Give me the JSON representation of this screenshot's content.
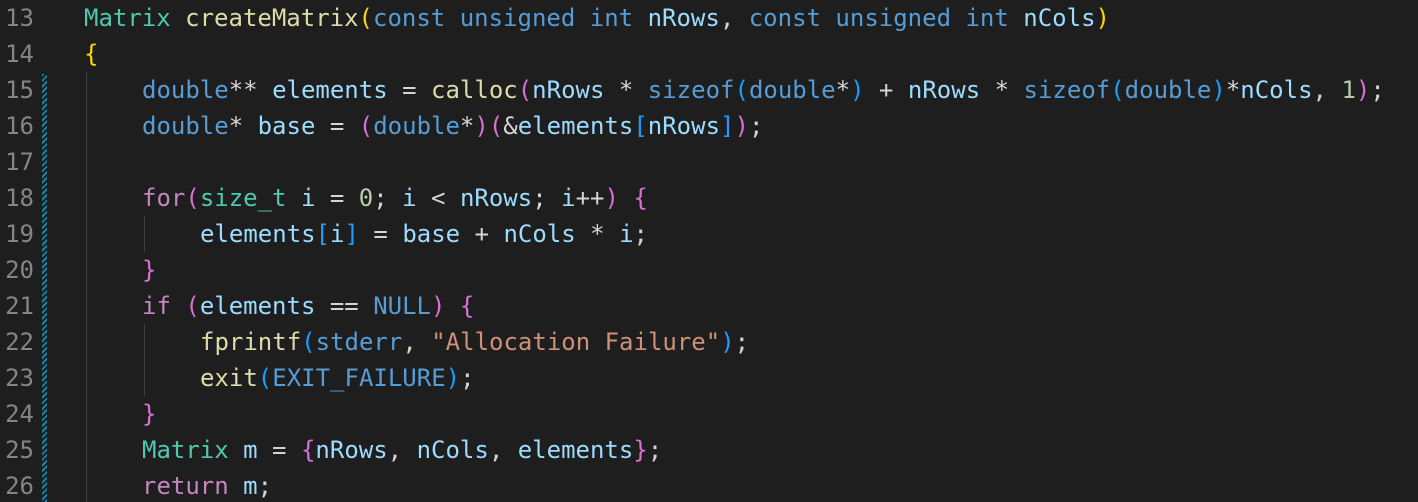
{
  "editor": {
    "line_numbers": [
      "13",
      "14",
      "15",
      "16",
      "17",
      "18",
      "19",
      "20",
      "21",
      "22",
      "23",
      "24",
      "25",
      "26"
    ],
    "lines": [
      {
        "indent": 0,
        "tokens": [
          {
            "t": "Matrix",
            "c": "type"
          },
          {
            "t": " ",
            "c": "op"
          },
          {
            "t": "createMatrix",
            "c": "fn"
          },
          {
            "t": "(",
            "c": "b1"
          },
          {
            "t": "const",
            "c": "kw"
          },
          {
            "t": " ",
            "c": "op"
          },
          {
            "t": "unsigned",
            "c": "kw"
          },
          {
            "t": " ",
            "c": "op"
          },
          {
            "t": "int",
            "c": "kw"
          },
          {
            "t": " ",
            "c": "op"
          },
          {
            "t": "nRows",
            "c": "var"
          },
          {
            "t": ", ",
            "c": "op"
          },
          {
            "t": "const",
            "c": "kw"
          },
          {
            "t": " ",
            "c": "op"
          },
          {
            "t": "unsigned",
            "c": "kw"
          },
          {
            "t": " ",
            "c": "op"
          },
          {
            "t": "int",
            "c": "kw"
          },
          {
            "t": " ",
            "c": "op"
          },
          {
            "t": "nCols",
            "c": "var"
          },
          {
            "t": ")",
            "c": "b1"
          }
        ]
      },
      {
        "indent": 0,
        "tokens": [
          {
            "t": "{",
            "c": "b1"
          }
        ]
      },
      {
        "indent": 1,
        "tokens": [
          {
            "t": "double",
            "c": "kw"
          },
          {
            "t": "** ",
            "c": "op"
          },
          {
            "t": "elements",
            "c": "var"
          },
          {
            "t": " = ",
            "c": "op"
          },
          {
            "t": "calloc",
            "c": "fn"
          },
          {
            "t": "(",
            "c": "b2"
          },
          {
            "t": "nRows",
            "c": "var"
          },
          {
            "t": " * ",
            "c": "op"
          },
          {
            "t": "sizeof",
            "c": "kw"
          },
          {
            "t": "(",
            "c": "b3"
          },
          {
            "t": "double",
            "c": "kw"
          },
          {
            "t": "*",
            "c": "op"
          },
          {
            "t": ")",
            "c": "b3"
          },
          {
            "t": " + ",
            "c": "op"
          },
          {
            "t": "nRows",
            "c": "var"
          },
          {
            "t": " * ",
            "c": "op"
          },
          {
            "t": "sizeof",
            "c": "kw"
          },
          {
            "t": "(",
            "c": "b3"
          },
          {
            "t": "double",
            "c": "kw"
          },
          {
            "t": ")",
            "c": "b3"
          },
          {
            "t": "*",
            "c": "op"
          },
          {
            "t": "nCols",
            "c": "var"
          },
          {
            "t": ", ",
            "c": "op"
          },
          {
            "t": "1",
            "c": "num"
          },
          {
            "t": ")",
            "c": "b2"
          },
          {
            "t": ";",
            "c": "op"
          }
        ]
      },
      {
        "indent": 1,
        "tokens": [
          {
            "t": "double",
            "c": "kw"
          },
          {
            "t": "* ",
            "c": "op"
          },
          {
            "t": "base",
            "c": "var"
          },
          {
            "t": " = ",
            "c": "op"
          },
          {
            "t": "(",
            "c": "b2"
          },
          {
            "t": "double",
            "c": "kw"
          },
          {
            "t": "*",
            "c": "op"
          },
          {
            "t": ")",
            "c": "b2"
          },
          {
            "t": "(",
            "c": "b2"
          },
          {
            "t": "&",
            "c": "op"
          },
          {
            "t": "elements",
            "c": "var"
          },
          {
            "t": "[",
            "c": "b3"
          },
          {
            "t": "nRows",
            "c": "var"
          },
          {
            "t": "]",
            "c": "b3"
          },
          {
            "t": ")",
            "c": "b2"
          },
          {
            "t": ";",
            "c": "op"
          }
        ]
      },
      {
        "indent": 1,
        "tokens": []
      },
      {
        "indent": 1,
        "tokens": [
          {
            "t": "for",
            "c": "ctrl"
          },
          {
            "t": "(",
            "c": "b2"
          },
          {
            "t": "size_t",
            "c": "type"
          },
          {
            "t": " ",
            "c": "op"
          },
          {
            "t": "i",
            "c": "var"
          },
          {
            "t": " = ",
            "c": "op"
          },
          {
            "t": "0",
            "c": "num"
          },
          {
            "t": "; ",
            "c": "op"
          },
          {
            "t": "i",
            "c": "var"
          },
          {
            "t": " < ",
            "c": "op"
          },
          {
            "t": "nRows",
            "c": "var"
          },
          {
            "t": "; ",
            "c": "op"
          },
          {
            "t": "i",
            "c": "var"
          },
          {
            "t": "++",
            "c": "op"
          },
          {
            "t": ")",
            "c": "b2"
          },
          {
            "t": " ",
            "c": "op"
          },
          {
            "t": "{",
            "c": "b2"
          }
        ]
      },
      {
        "indent": 2,
        "tokens": [
          {
            "t": "elements",
            "c": "var"
          },
          {
            "t": "[",
            "c": "b3"
          },
          {
            "t": "i",
            "c": "var"
          },
          {
            "t": "]",
            "c": "b3"
          },
          {
            "t": " = ",
            "c": "op"
          },
          {
            "t": "base",
            "c": "var"
          },
          {
            "t": " + ",
            "c": "op"
          },
          {
            "t": "nCols",
            "c": "var"
          },
          {
            "t": " * ",
            "c": "op"
          },
          {
            "t": "i",
            "c": "var"
          },
          {
            "t": ";",
            "c": "op"
          }
        ]
      },
      {
        "indent": 1,
        "tokens": [
          {
            "t": "}",
            "c": "b2"
          }
        ]
      },
      {
        "indent": 1,
        "tokens": [
          {
            "t": "if",
            "c": "ctrl"
          },
          {
            "t": " ",
            "c": "op"
          },
          {
            "t": "(",
            "c": "b2"
          },
          {
            "t": "elements",
            "c": "var"
          },
          {
            "t": " == ",
            "c": "op"
          },
          {
            "t": "NULL",
            "c": "kw"
          },
          {
            "t": ")",
            "c": "b2"
          },
          {
            "t": " ",
            "c": "op"
          },
          {
            "t": "{",
            "c": "b2"
          }
        ]
      },
      {
        "indent": 2,
        "tokens": [
          {
            "t": "fprintf",
            "c": "fn"
          },
          {
            "t": "(",
            "c": "b3"
          },
          {
            "t": "stderr",
            "c": "kw"
          },
          {
            "t": ", ",
            "c": "op"
          },
          {
            "t": "\"Allocation Failure\"",
            "c": "str"
          },
          {
            "t": ")",
            "c": "b3"
          },
          {
            "t": ";",
            "c": "op"
          }
        ]
      },
      {
        "indent": 2,
        "tokens": [
          {
            "t": "exit",
            "c": "fn"
          },
          {
            "t": "(",
            "c": "b3"
          },
          {
            "t": "EXIT_FAILURE",
            "c": "kw"
          },
          {
            "t": ")",
            "c": "b3"
          },
          {
            "t": ";",
            "c": "op"
          }
        ]
      },
      {
        "indent": 1,
        "tokens": [
          {
            "t": "}",
            "c": "b2"
          }
        ]
      },
      {
        "indent": 1,
        "tokens": [
          {
            "t": "Matrix",
            "c": "type"
          },
          {
            "t": " ",
            "c": "op"
          },
          {
            "t": "m",
            "c": "var"
          },
          {
            "t": " = ",
            "c": "op"
          },
          {
            "t": "{",
            "c": "b2"
          },
          {
            "t": "nRows",
            "c": "var"
          },
          {
            "t": ", ",
            "c": "op"
          },
          {
            "t": "nCols",
            "c": "var"
          },
          {
            "t": ", ",
            "c": "op"
          },
          {
            "t": "elements",
            "c": "var"
          },
          {
            "t": "}",
            "c": "b2"
          },
          {
            "t": ";",
            "c": "op"
          }
        ]
      },
      {
        "indent": 1,
        "tokens": [
          {
            "t": "return",
            "c": "ctrl"
          },
          {
            "t": " ",
            "c": "op"
          },
          {
            "t": "m",
            "c": "var"
          },
          {
            "t": ";",
            "c": "op"
          }
        ]
      }
    ],
    "modified_line_range": [
      "15",
      "26"
    ]
  },
  "colors": {
    "background": "#1e1e1e",
    "line_number": "#858585",
    "modified_gutter": "#1b81a8",
    "indent_guide": "#404040"
  }
}
